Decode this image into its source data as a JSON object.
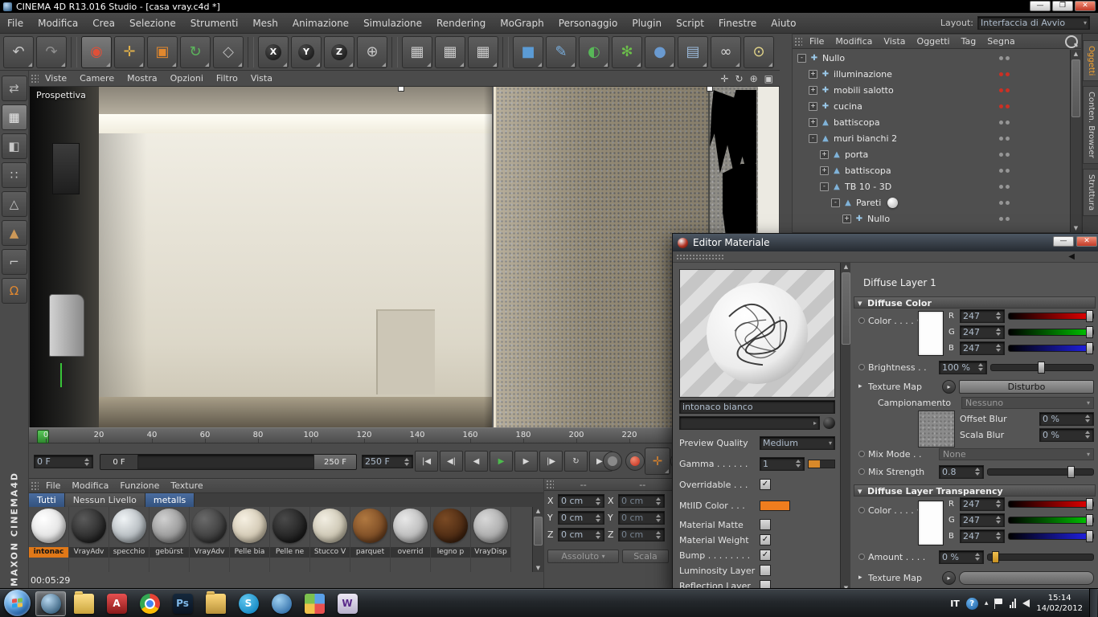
{
  "window": {
    "title": "CINEMA 4D R13.016 Studio - [casa vray.c4d *]",
    "menus": [
      "File",
      "Modifica",
      "Crea",
      "Selezione",
      "Strumenti",
      "Mesh",
      "Animazione",
      "Simulazione",
      "Rendering",
      "MoGraph",
      "Personaggio",
      "Plugin",
      "Script",
      "Finestre",
      "Aiuto"
    ],
    "layout_label": "Layout:",
    "layout_value": "Interfaccia di Avvio"
  },
  "toolbar": [
    {
      "name": "undo",
      "glyph": "↶",
      "color": "#c6c6c6"
    },
    {
      "name": "redo",
      "glyph": "↷",
      "color": "#8e8e8e"
    },
    {
      "name": "sep"
    },
    {
      "name": "live-selection",
      "glyph": "◉",
      "color": "#e05038",
      "active": true
    },
    {
      "name": "move-tool",
      "glyph": "✛",
      "color": "#dfaf4a"
    },
    {
      "name": "scale-tool",
      "glyph": "▣",
      "color": "#e2882e"
    },
    {
      "name": "rotate-tool",
      "glyph": "↻",
      "color": "#5cb55c"
    },
    {
      "name": "last-tool",
      "glyph": "◇",
      "color": "#b8b8b8"
    },
    {
      "name": "sep"
    },
    {
      "name": "lock-x-axis",
      "glyph": "X",
      "circle": true
    },
    {
      "name": "lock-y-axis",
      "glyph": "Y",
      "circle": true
    },
    {
      "name": "lock-z-axis",
      "glyph": "Z",
      "circle": true
    },
    {
      "name": "coordinate-system",
      "glyph": "⊕",
      "color": "#c6c6c6"
    },
    {
      "name": "sep"
    },
    {
      "name": "render-view",
      "glyph": "▦",
      "color": "#cccccc"
    },
    {
      "name": "render-picture-viewer",
      "glyph": "▦",
      "color": "#cccccc"
    },
    {
      "name": "render-settings",
      "glyph": "▦",
      "color": "#cccccc"
    },
    {
      "name": "sep"
    },
    {
      "name": "add-cube",
      "glyph": "■",
      "color": "#5b9bd5"
    },
    {
      "name": "add-spline",
      "glyph": "✎",
      "color": "#79aede"
    },
    {
      "name": "add-generator",
      "glyph": "◐",
      "color": "#58b858"
    },
    {
      "name": "add-mograph",
      "glyph": "✻",
      "color": "#6cc04a"
    },
    {
      "name": "add-deformer",
      "glyph": "●",
      "color": "#6a9ad0"
    },
    {
      "name": "add-environment",
      "glyph": "▤",
      "color": "#9ab8d8"
    },
    {
      "name": "add-camera",
      "glyph": "∞",
      "color": "#d8d8d8"
    },
    {
      "name": "add-light",
      "glyph": "⊙",
      "color": "#e6d88a"
    }
  ],
  "side_toolbar": [
    {
      "name": "make-editable",
      "glyph": "⇄",
      "color": "#b8b8b8"
    },
    {
      "name": "model-mode",
      "glyph": "▦",
      "color": "#e8e8e8",
      "active": true
    },
    {
      "name": "texture-mode",
      "glyph": "◧",
      "color": "#c8c8c8"
    },
    {
      "name": "points-mode",
      "glyph": "∷",
      "color": "#c8c8c8"
    },
    {
      "name": "edges-mode",
      "glyph": "△",
      "color": "#c8c8c8"
    },
    {
      "name": "polygons-mode",
      "glyph": "▲",
      "color": "#cc9858"
    },
    {
      "name": "axis-mode",
      "glyph": "⌐",
      "color": "#c8c8c8"
    },
    {
      "name": "snap-settings",
      "glyph": "Ω",
      "color": "#e08830"
    }
  ],
  "viewport": {
    "camera_label": "Prospettiva",
    "menus": [
      "Viste",
      "Camere",
      "Mostra",
      "Opzioni",
      "Filtro",
      "Vista"
    ]
  },
  "timeline": {
    "ticks": [
      "0",
      "20",
      "40",
      "60",
      "80",
      "100",
      "120",
      "140",
      "160",
      "180",
      "200",
      "220"
    ]
  },
  "transport": {
    "current_frame": "0 F",
    "range_start": "0 F",
    "range_end": "250 F",
    "end_field": "250 F",
    "buttons": [
      {
        "name": "goto-start",
        "glyph": "|◀"
      },
      {
        "name": "previous-key",
        "glyph": "◀|"
      },
      {
        "name": "previous-frame",
        "glyph": "◀"
      },
      {
        "name": "play",
        "glyph": "▶",
        "color": "#4dbb4d"
      },
      {
        "name": "next-frame",
        "glyph": "▶"
      },
      {
        "name": "next-key",
        "glyph": "|▶"
      },
      {
        "name": "loop",
        "glyph": "↻"
      },
      {
        "name": "goto-end",
        "glyph": "▶|"
      }
    ]
  },
  "materials": {
    "menus": [
      "File",
      "Modifica",
      "Funzione",
      "Texture"
    ],
    "tabs": [
      {
        "label": "Tutti",
        "highlight": true
      },
      {
        "label": "Nessun Livello",
        "highlight": false
      },
      {
        "label": "metalls",
        "highlight": true
      }
    ],
    "items": [
      {
        "label": "intonac",
        "c1": "#ffffff",
        "c2": "#cfcfcf",
        "selected": true
      },
      {
        "label": "VrayAdv",
        "c1": "#5a5a5a",
        "c2": "#0e0e0e"
      },
      {
        "label": "specchio",
        "c1": "#f0f4f6",
        "c2": "#8a9298"
      },
      {
        "label": "gebürst",
        "c1": "#d0d0d0",
        "c2": "#707070"
      },
      {
        "label": "VrayAdv",
        "c1": "#6a6a6a",
        "c2": "#222222"
      },
      {
        "label": "Pelle bia",
        "c1": "#f6f0e2",
        "c2": "#b8ac92"
      },
      {
        "label": "Pelle ne",
        "c1": "#4a4a4a",
        "c2": "#0a0a0a"
      },
      {
        "label": "Stucco V",
        "c1": "#f2eee2",
        "c2": "#b0a890"
      },
      {
        "label": "parquet",
        "c1": "#b07840",
        "c2": "#5a3014"
      },
      {
        "label": "overrid",
        "c1": "#e8e8e8",
        "c2": "#9a9a9a"
      },
      {
        "label": "legno p",
        "c1": "#7a4a24",
        "c2": "#2e1608"
      },
      {
        "label": "VrayDisp",
        "c1": "#d8d8d8",
        "c2": "#8a8a8a"
      }
    ]
  },
  "status": {
    "elapsed": "00:05:29"
  },
  "branding": "MAXON CINEMA4D",
  "coordinates": {
    "header_left": "--",
    "header_right": "--",
    "rows": [
      {
        "a": "X",
        "v": "0 cm",
        "a2": "X",
        "v2": "0 cm"
      },
      {
        "a": "Y",
        "v": "0 cm",
        "a2": "Y",
        "v2": "0 cm"
      },
      {
        "a": "Z",
        "v": "0 cm",
        "a2": "Z",
        "v2": "0 cm"
      }
    ],
    "mode": "Assoluto",
    "apply": "Scala"
  },
  "object_manager": {
    "menus": [
      "File",
      "Modifica",
      "Vista",
      "Oggetti",
      "Tag",
      "Segna"
    ],
    "items": [
      {
        "label": "Nullo",
        "depth": 0,
        "expander": "minus",
        "icon": "null",
        "dots": "gray"
      },
      {
        "label": "illuminazione",
        "depth": 1,
        "expander": "plus",
        "icon": "null",
        "dots": "red"
      },
      {
        "label": "mobili salotto",
        "depth": 1,
        "expander": "plus",
        "icon": "null",
        "dots": "red"
      },
      {
        "label": "cucina",
        "depth": 1,
        "expander": "plus",
        "icon": "null",
        "dots": "red"
      },
      {
        "label": "battiscopa",
        "depth": 1,
        "expander": "plus",
        "icon": "poly",
        "dots": "gray"
      },
      {
        "label": "muri bianchi 2",
        "depth": 1,
        "expander": "minus",
        "icon": "poly",
        "dots": "gray"
      },
      {
        "label": "porta",
        "depth": 2,
        "expander": "plus",
        "icon": "poly",
        "dots": "gray"
      },
      {
        "label": "battiscopa",
        "depth": 2,
        "expander": "plus",
        "icon": "poly",
        "dots": "gray"
      },
      {
        "label": "TB 10 - 3D",
        "depth": 2,
        "expander": "minus",
        "icon": "poly",
        "dots": "gray"
      },
      {
        "label": "Pareti",
        "depth": 3,
        "expander": "minus",
        "icon": "poly",
        "dots": "gray",
        "tag": true
      },
      {
        "label": "Nullo",
        "depth": 4,
        "expander": "plus",
        "icon": "null",
        "dots": "gray"
      }
    ]
  },
  "side_tabs": [
    {
      "label": "Oggetti",
      "active": true
    },
    {
      "label": "Conten. Browser",
      "active": false
    },
    {
      "label": "Struttura",
      "active": false
    }
  ],
  "material_editor": {
    "title": "Editor Materiale",
    "material_name": "intonaco bianco",
    "preview_quality_label": "Preview Quality",
    "preview_quality": "Medium",
    "gamma_label": "Gamma . . . . . .",
    "gamma_value": "1",
    "overridable_label": "Overridable . . .",
    "mtlid_label": "MtlID Color . . .",
    "props": [
      {
        "label": "Material Matte",
        "checked": false
      },
      {
        "label": "Material Weight",
        "checked": true
      },
      {
        "label": "Bump . . . . . . . .",
        "checked": true
      },
      {
        "label": "Luminosity Layer",
        "checked": false
      },
      {
        "label": "Reflection Layer",
        "checked": false
      }
    ],
    "right": {
      "header": "Diffuse Layer 1",
      "section1": "Diffuse Color",
      "color_label": "Color . . . .",
      "r_label": "R",
      "g_label": "G",
      "b_label": "B",
      "r": "247",
      "g": "247",
      "b": "247",
      "brightness_label": "Brightness . .",
      "brightness": "100 %",
      "texture_map_label": "Texture Map",
      "texture_button": "Disturbo",
      "sampling_label": "Campionamento",
      "sampling_value": "Nessuno",
      "offset_blur_label": "Offset Blur",
      "offset_blur": "0 %",
      "scale_blur_label": "Scala Blur",
      "scale_blur": "0 %",
      "mix_mode_label": "Mix Mode . .",
      "mix_mode": "None",
      "mix_strength_label": "Mix Strength",
      "mix_strength": "0.8",
      "section2": "Diffuse Layer Transparency",
      "t_color_label": "Color . . . .",
      "t_r": "247",
      "t_g": "247",
      "t_b": "247",
      "amount_label": "Amount . . . .",
      "amount": "0 %",
      "t_texture_map_label": "Texture Map"
    }
  },
  "taskbar": {
    "icons": [
      {
        "name": "cinema4d",
        "kind": "sphere",
        "c1": "#b8d8f0",
        "c2": "#16405f",
        "active": true
      },
      {
        "name": "explorer",
        "kind": "folder",
        "c1": "#ffe08a",
        "c2": "#caa53d"
      },
      {
        "name": "reader",
        "kind": "sq",
        "c1": "#e85050",
        "c2": "#8a1a1a",
        "glyph": "A",
        "gcolor": "#ffffff"
      },
      {
        "name": "chrome",
        "kind": "chrome"
      },
      {
        "name": "photoshop",
        "kind": "sq",
        "c1": "#15283c",
        "c2": "#0a1422",
        "glyph": "Ps",
        "gcolor": "#7fb8e8"
      },
      {
        "name": "folder",
        "kind": "folder",
        "c1": "#ffd87a",
        "c2": "#b8923a"
      },
      {
        "name": "skype",
        "kind": "sphere",
        "c1": "#62c8f0",
        "c2": "#0078b8",
        "glyph": "S",
        "gcolor": "#ffffff"
      },
      {
        "name": "app-blue",
        "kind": "sphere",
        "c1": "#9fd0f0",
        "c2": "#1a5a9a"
      },
      {
        "name": "app-colors",
        "kind": "quad"
      },
      {
        "name": "writer",
        "kind": "sq",
        "c1": "#ece8f4",
        "c2": "#b8b0cc",
        "glyph": "W",
        "gcolor": "#5a2a8a"
      }
    ],
    "tray_lang": "IT",
    "time": "15:14",
    "date": "14/02/2012"
  }
}
